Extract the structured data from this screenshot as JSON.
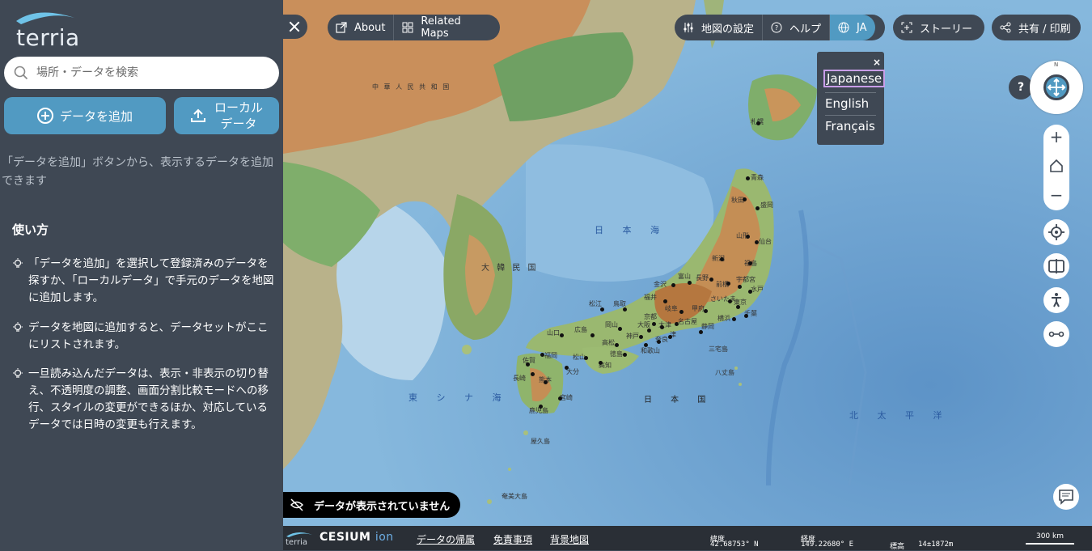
{
  "sidebar": {
    "logo_text": "terria",
    "search_placeholder": "場所・データを検索",
    "add_data_label": "データを追加",
    "local_data_label_1": "ローカル",
    "local_data_label_2": "データ",
    "hint": "「データを追加」ボタンから、表示するデータを追加できます",
    "howto_title": "使い方",
    "tips": [
      "「データを追加」を選択して登録済みのデータを探すか、「ローカルデータ」で手元のデータを地図に追加します。",
      "データを地図に追加すると、データセットがここにリストされます。",
      "一旦読み込んだデータは、表示・非表示の切り替え、不透明度の調整、画面分割比較モードへの移行、スタイルの変更ができるほか、対応しているデータでは日時の変更も行えます。"
    ]
  },
  "toolbar": {
    "about": "About",
    "related_maps": "Related Maps",
    "map_settings": "地図の設定",
    "help": "ヘルプ",
    "language": "JA",
    "story": "ストーリー",
    "share": "共有 / 印刷"
  },
  "language_menu": {
    "close": "×",
    "options": [
      "Japanese",
      "English",
      "Français"
    ],
    "selected": "Japanese"
  },
  "map_controls": {
    "help": "?",
    "compass_north": "N",
    "zoom_in": "+",
    "zoom_out": "−"
  },
  "status": {
    "no_data": "データが表示されていません"
  },
  "map_labels": {
    "sea_of_japan": "日 本 海",
    "east_china_sea": "東 シ ナ 海",
    "pacific": "北 太 平 洋",
    "japan": "日 本 国",
    "korea": "大 韓 民 国",
    "china": "中 華 人 民 共 和 国",
    "cities": [
      "札幌",
      "青森",
      "秋田",
      "盛岡",
      "山形",
      "仙台",
      "新潟",
      "福島",
      "金沢",
      "富山",
      "長野",
      "前橋",
      "宇都宮",
      "水戸",
      "松江",
      "鳥取",
      "福井",
      "岐阜",
      "甲府",
      "さいたま",
      "東京",
      "千葉",
      "横浜",
      "広島",
      "山口",
      "岡山",
      "神戸",
      "京都",
      "大阪",
      "大津",
      "名古屋",
      "静岡",
      "福岡",
      "松山",
      "高松",
      "徳島",
      "和歌山",
      "奈良",
      "津",
      "佐賀",
      "長崎",
      "熊本",
      "大分",
      "高知",
      "宮崎",
      "鹿児島",
      "八丈島",
      "三宅島",
      "屋久島",
      "奄美大島"
    ]
  },
  "bottom": {
    "terria_logo": "terria",
    "cesium": "CESIUM",
    "ion": "ion",
    "credit_data": "データの帰属",
    "credit_disclaimer": "免責事項",
    "credit_basemap": "背景地図",
    "lat_label": "緯度",
    "lat_value": "42.68753° N",
    "lon_label": "経度",
    "lon_value": "149.22680° E",
    "elev_label": "標高",
    "elev_value": "14±1872m",
    "scale": "300 km"
  }
}
